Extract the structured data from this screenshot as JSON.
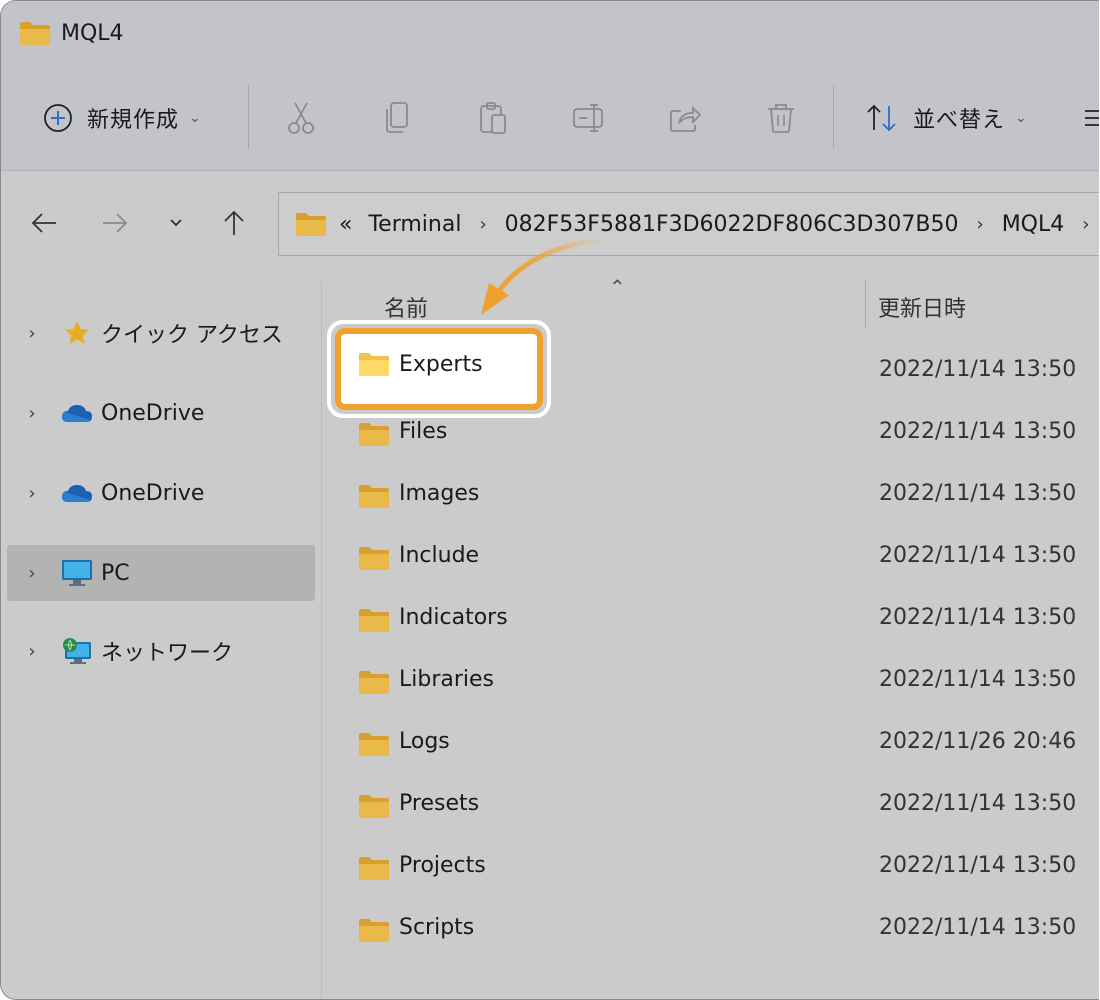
{
  "window": {
    "title": "MQL4"
  },
  "toolbar": {
    "new_label": "新規作成",
    "sort_label": "並べ替え",
    "icons": [
      "plus-circle-icon",
      "cut-icon",
      "copy-icon",
      "paste-icon",
      "rename-icon",
      "share-icon",
      "delete-icon",
      "sort-icon",
      "more-icon"
    ]
  },
  "address": {
    "overflow": "«",
    "crumbs": [
      "Terminal",
      "082F53F5881F3D6022DF806C3D307B50",
      "MQL4"
    ]
  },
  "nav": {
    "items": [
      {
        "label": "クイック アクセス",
        "icon": "star-icon"
      },
      {
        "label": "OneDrive",
        "icon": "cloud-icon"
      },
      {
        "label": "OneDrive",
        "icon": "cloud-icon"
      },
      {
        "label": "PC",
        "icon": "monitor-icon"
      },
      {
        "label": "ネットワーク",
        "icon": "network-icon"
      }
    ]
  },
  "list": {
    "col_name": "名前",
    "col_date": "更新日時",
    "rows": [
      {
        "name": "Experts",
        "date": "2022/11/14 13:50"
      },
      {
        "name": "Files",
        "date": "2022/11/14 13:50"
      },
      {
        "name": "Images",
        "date": "2022/11/14 13:50"
      },
      {
        "name": "Include",
        "date": "2022/11/14 13:50"
      },
      {
        "name": "Indicators",
        "date": "2022/11/14 13:50"
      },
      {
        "name": "Libraries",
        "date": "2022/11/14 13:50"
      },
      {
        "name": "Logs",
        "date": "2022/11/26 20:46"
      },
      {
        "name": "Presets",
        "date": "2022/11/14 13:50"
      },
      {
        "name": "Projects",
        "date": "2022/11/14 13:50"
      },
      {
        "name": "Scripts",
        "date": "2022/11/14 13:50"
      }
    ]
  },
  "colors": {
    "highlight": "#f0a02c",
    "folder": "#e8b640",
    "accent_blue": "#2f6fc0"
  }
}
